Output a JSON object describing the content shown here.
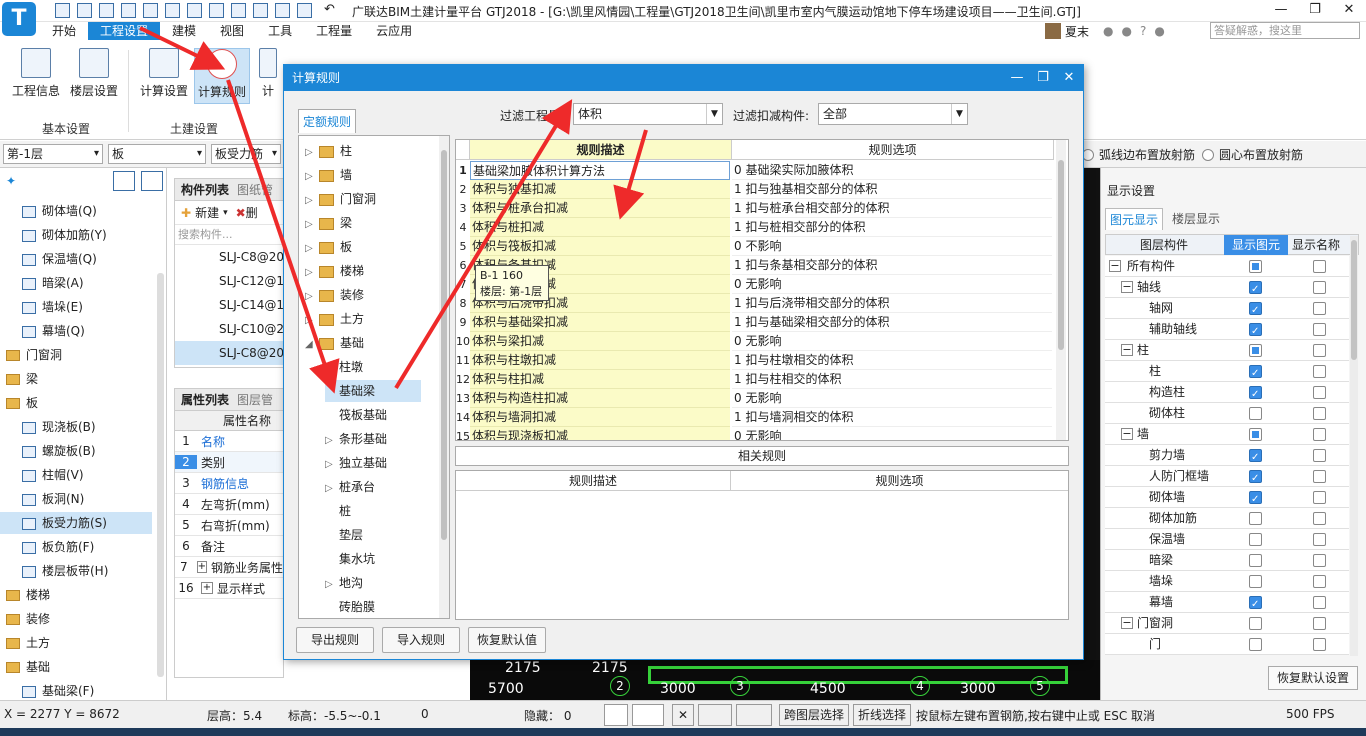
{
  "app": {
    "logo_letter": "T",
    "window_title": "广联达BIM土建计量平台 GTJ2018 - [G:\\凯里风情园\\工程量\\GTJ2018卫生间\\凯里市室内气膜运动馆地下停车场建设项目——卫生间.GTJ]",
    "window_controls": [
      "—",
      "❐",
      "✕"
    ]
  },
  "menu": {
    "items": [
      "开始",
      "工程设置",
      "建模",
      "视图",
      "工具",
      "工程量",
      "云应用"
    ],
    "active": "工程设置",
    "user_name": "夏末",
    "search_placeholder": "答疑解惑，搜这里"
  },
  "ribbon": {
    "buttons": [
      "工程信息",
      "楼层设置",
      "计算设置",
      "计算规则",
      "计"
    ],
    "groups": [
      "基本设置",
      "土建设置"
    ]
  },
  "toolbar": {
    "floor": "第-1层",
    "category": "板",
    "type": "板受力筋",
    "radio_arc": "弧线边布置放射筋",
    "radio_center": "圆心布置放射筋"
  },
  "leftnav": {
    "items": [
      {
        "label": "砌体墙(Q)",
        "kind": "icon",
        "indent": 1
      },
      {
        "label": "砌体加筋(Y)",
        "kind": "icon",
        "indent": 1
      },
      {
        "label": "保温墙(Q)",
        "kind": "icon",
        "indent": 1
      },
      {
        "label": "暗梁(A)",
        "kind": "icon",
        "indent": 1
      },
      {
        "label": "墙垛(E)",
        "kind": "icon",
        "indent": 1
      },
      {
        "label": "幕墙(Q)",
        "kind": "icon",
        "indent": 1
      },
      {
        "label": "门窗洞",
        "kind": "folder",
        "indent": 0
      },
      {
        "label": "梁",
        "kind": "folder",
        "indent": 0
      },
      {
        "label": "板",
        "kind": "folder",
        "indent": 0
      },
      {
        "label": "现浇板(B)",
        "kind": "icon",
        "indent": 1
      },
      {
        "label": "螺旋板(B)",
        "kind": "icon",
        "indent": 1
      },
      {
        "label": "柱帽(V)",
        "kind": "icon",
        "indent": 1
      },
      {
        "label": "板洞(N)",
        "kind": "icon",
        "indent": 1
      },
      {
        "label": "板受力筋(S)",
        "kind": "icon",
        "indent": 1,
        "selected": true
      },
      {
        "label": "板负筋(F)",
        "kind": "icon",
        "indent": 1
      },
      {
        "label": "楼层板带(H)",
        "kind": "icon",
        "indent": 1
      },
      {
        "label": "楼梯",
        "kind": "folder",
        "indent": 0
      },
      {
        "label": "装修",
        "kind": "folder",
        "indent": 0
      },
      {
        "label": "土方",
        "kind": "folder",
        "indent": 0
      },
      {
        "label": "基础",
        "kind": "folder",
        "indent": 0
      },
      {
        "label": "基础梁(F)",
        "kind": "icon",
        "indent": 1
      }
    ]
  },
  "complist": {
    "tabs": [
      "构件列表",
      "图纸管"
    ],
    "new_label": "新建",
    "delete_label": "删",
    "search_placeholder": "搜索构件...",
    "items": [
      "SLJ-C8@20",
      "SLJ-C12@1",
      "SLJ-C14@1",
      "SLJ-C10@2",
      "SLJ-C8@20"
    ]
  },
  "proplist": {
    "tabs": [
      "属性列表",
      "图层管"
    ],
    "header": "属性名称",
    "rows": [
      {
        "n": "1",
        "name": "名称",
        "blue": true
      },
      {
        "n": "2",
        "name": "类别",
        "blue": false
      },
      {
        "n": "3",
        "name": "钢筋信息",
        "blue": true
      },
      {
        "n": "4",
        "name": "左弯折(mm)",
        "blue": false
      },
      {
        "n": "5",
        "name": "右弯折(mm)",
        "blue": false
      },
      {
        "n": "6",
        "name": "备注",
        "blue": false
      },
      {
        "n": "7",
        "name": "钢筋业务属性",
        "blue": false,
        "expand": true
      },
      {
        "n": "16",
        "name": "显示样式",
        "blue": false,
        "expand": true
      }
    ]
  },
  "canvas": {
    "dim_top": [
      "2175",
      "2175"
    ],
    "dim_bottom": [
      "5700",
      "3000",
      "4500",
      "3000"
    ],
    "axis_labels": [
      "2",
      "3",
      "4",
      "5"
    ]
  },
  "rightpanel": {
    "title": "显示设置",
    "tabs": [
      "图元显示",
      "楼层显示"
    ],
    "col_headers": [
      "图层构件",
      "显示图元",
      "显示名称"
    ],
    "rows": [
      {
        "label": "所有构件",
        "level": 0,
        "expander": "−",
        "show": "partial",
        "name": false
      },
      {
        "label": "轴线",
        "level": 1,
        "expander": "−",
        "show": true,
        "name": false
      },
      {
        "label": "轴网",
        "level": 2,
        "show": true,
        "name": false
      },
      {
        "label": "辅助轴线",
        "level": 2,
        "show": true,
        "name": false
      },
      {
        "label": "柱",
        "level": 1,
        "expander": "−",
        "show": "partial",
        "name": false
      },
      {
        "label": "柱",
        "level": 2,
        "show": true,
        "name": false
      },
      {
        "label": "构造柱",
        "level": 2,
        "show": true,
        "name": false
      },
      {
        "label": "砌体柱",
        "level": 2,
        "show": false,
        "name": false
      },
      {
        "label": "墙",
        "level": 1,
        "expander": "−",
        "show": "partial",
        "name": false
      },
      {
        "label": "剪力墙",
        "level": 2,
        "show": true,
        "name": false
      },
      {
        "label": "人防门框墙",
        "level": 2,
        "show": true,
        "name": false
      },
      {
        "label": "砌体墙",
        "level": 2,
        "show": true,
        "name": false
      },
      {
        "label": "砌体加筋",
        "level": 2,
        "show": false,
        "name": false
      },
      {
        "label": "保温墙",
        "level": 2,
        "show": false,
        "name": false
      },
      {
        "label": "暗梁",
        "level": 2,
        "show": false,
        "name": false
      },
      {
        "label": "墙垛",
        "level": 2,
        "show": false,
        "name": false
      },
      {
        "label": "幕墙",
        "level": 2,
        "show": true,
        "name": false
      },
      {
        "label": "门窗洞",
        "level": 1,
        "expander": "−",
        "show": false,
        "name": false
      },
      {
        "label": "门",
        "level": 2,
        "show": false,
        "name": false
      }
    ],
    "restore_label": "恢复默认设置"
  },
  "statusbar": {
    "coords": "X = 2277 Y = 8672",
    "floor_height": "层高：5.4",
    "elevation": "标高：-5.5~-0.1",
    "zero": "0",
    "hidden": "隐藏： 0",
    "cross_layer": "跨图层选择",
    "polyline": "折线选择",
    "hint": "按鼠标左键布置钢筋,按右键中止或 ESC 取消",
    "fps": "500 FPS"
  },
  "dialog": {
    "title": "计算规则",
    "tab": "定额规则",
    "filter_qty_label": "过滤工程量:",
    "filter_qty_value": "体积",
    "filter_deduct_label": "过滤扣减构件:",
    "filter_deduct_value": "全部",
    "tree": [
      {
        "label": "柱",
        "level": 0,
        "arrow": "▷",
        "folder": true
      },
      {
        "label": "墙",
        "level": 0,
        "arrow": "▷",
        "folder": true
      },
      {
        "label": "门窗洞",
        "level": 0,
        "arrow": "▷",
        "folder": true
      },
      {
        "label": "梁",
        "level": 0,
        "arrow": "▷",
        "folder": true
      },
      {
        "label": "板",
        "level": 0,
        "arrow": "▷",
        "folder": true
      },
      {
        "label": "楼梯",
        "level": 0,
        "arrow": "▷",
        "folder": true
      },
      {
        "label": "装修",
        "level": 0,
        "arrow": "▷",
        "folder": true
      },
      {
        "label": "土方",
        "level": 0,
        "arrow": "▷",
        "folder": true
      },
      {
        "label": "基础",
        "level": 0,
        "arrow": "◢",
        "folder": true
      },
      {
        "label": "柱墩",
        "level": 1,
        "arrow": "",
        "folder": false
      },
      {
        "label": "基础梁",
        "level": 1,
        "arrow": "",
        "folder": false,
        "selected": true
      },
      {
        "label": "筏板基础",
        "level": 1,
        "arrow": "",
        "folder": false
      },
      {
        "label": "条形基础",
        "level": 1,
        "arrow": "▷",
        "folder": false
      },
      {
        "label": "独立基础",
        "level": 1,
        "arrow": "▷",
        "folder": false
      },
      {
        "label": "桩承台",
        "level": 1,
        "arrow": "▷",
        "folder": false
      },
      {
        "label": "桩",
        "level": 1,
        "arrow": "",
        "folder": false
      },
      {
        "label": "垫层",
        "level": 1,
        "arrow": "",
        "folder": false
      },
      {
        "label": "集水坑",
        "level": 1,
        "arrow": "",
        "folder": false
      },
      {
        "label": "地沟",
        "level": 1,
        "arrow": "▷",
        "folder": false
      },
      {
        "label": "砖胎膜",
        "level": 1,
        "arrow": "",
        "folder": false
      }
    ],
    "grid_headers": [
      "规则描述",
      "规则选项"
    ],
    "rules": [
      {
        "n": "1",
        "desc": "基础梁加腋体积计算方法",
        "opt": "0  基础梁实际加腋体积"
      },
      {
        "n": "2",
        "desc": "体积与独基扣减",
        "opt": "1  扣与独基相交部分的体积"
      },
      {
        "n": "3",
        "desc": "体积与桩承台扣减",
        "opt": "1  扣与桩承台相交部分的体积"
      },
      {
        "n": "4",
        "desc": "体积与桩扣减",
        "opt": "1  扣与桩相交部分的体积"
      },
      {
        "n": "5",
        "desc": "体积与筏板扣减",
        "opt": "0  不影响"
      },
      {
        "n": "6",
        "desc": "体积与条基扣减",
        "opt": "1  扣与条基相交部分的体积"
      },
      {
        "n": "7",
        "desc": "体积与垫层扣减",
        "opt": "0  无影响"
      },
      {
        "n": "8",
        "desc": "体积与后浇带扣减",
        "opt": "1  扣与后浇带相交部分的体积"
      },
      {
        "n": "9",
        "desc": "体积与基础梁扣减",
        "opt": "1  扣与基础梁相交部分的体积"
      },
      {
        "n": "10",
        "desc": "体积与梁扣减",
        "opt": "0  无影响"
      },
      {
        "n": "11",
        "desc": "体积与柱墩扣减",
        "opt": "1  扣与柱墩相交的体积"
      },
      {
        "n": "12",
        "desc": "体积与柱扣减",
        "opt": "1  扣与柱相交的体积"
      },
      {
        "n": "13",
        "desc": "体积与构造柱扣减",
        "opt": "0  无影响"
      },
      {
        "n": "14",
        "desc": "体积与墙洞扣减",
        "opt": "1  扣与墙洞相交的体积"
      },
      {
        "n": "15",
        "desc": "体积与现浇板扣减",
        "opt": "0  无影响"
      }
    ],
    "related_label": "相关规则",
    "related_headers": [
      "规则描述",
      "规则选项"
    ],
    "tooltip_line1": "B-1 160",
    "tooltip_line2": "楼层: 第-1层",
    "buttons": [
      "导出规则",
      "导入规则",
      "恢复默认值"
    ]
  },
  "colors": {
    "accent": "#1b86d6",
    "annotation_arrow": "#ee2a2a",
    "rule_desc_bg": "#fbfbc8"
  }
}
